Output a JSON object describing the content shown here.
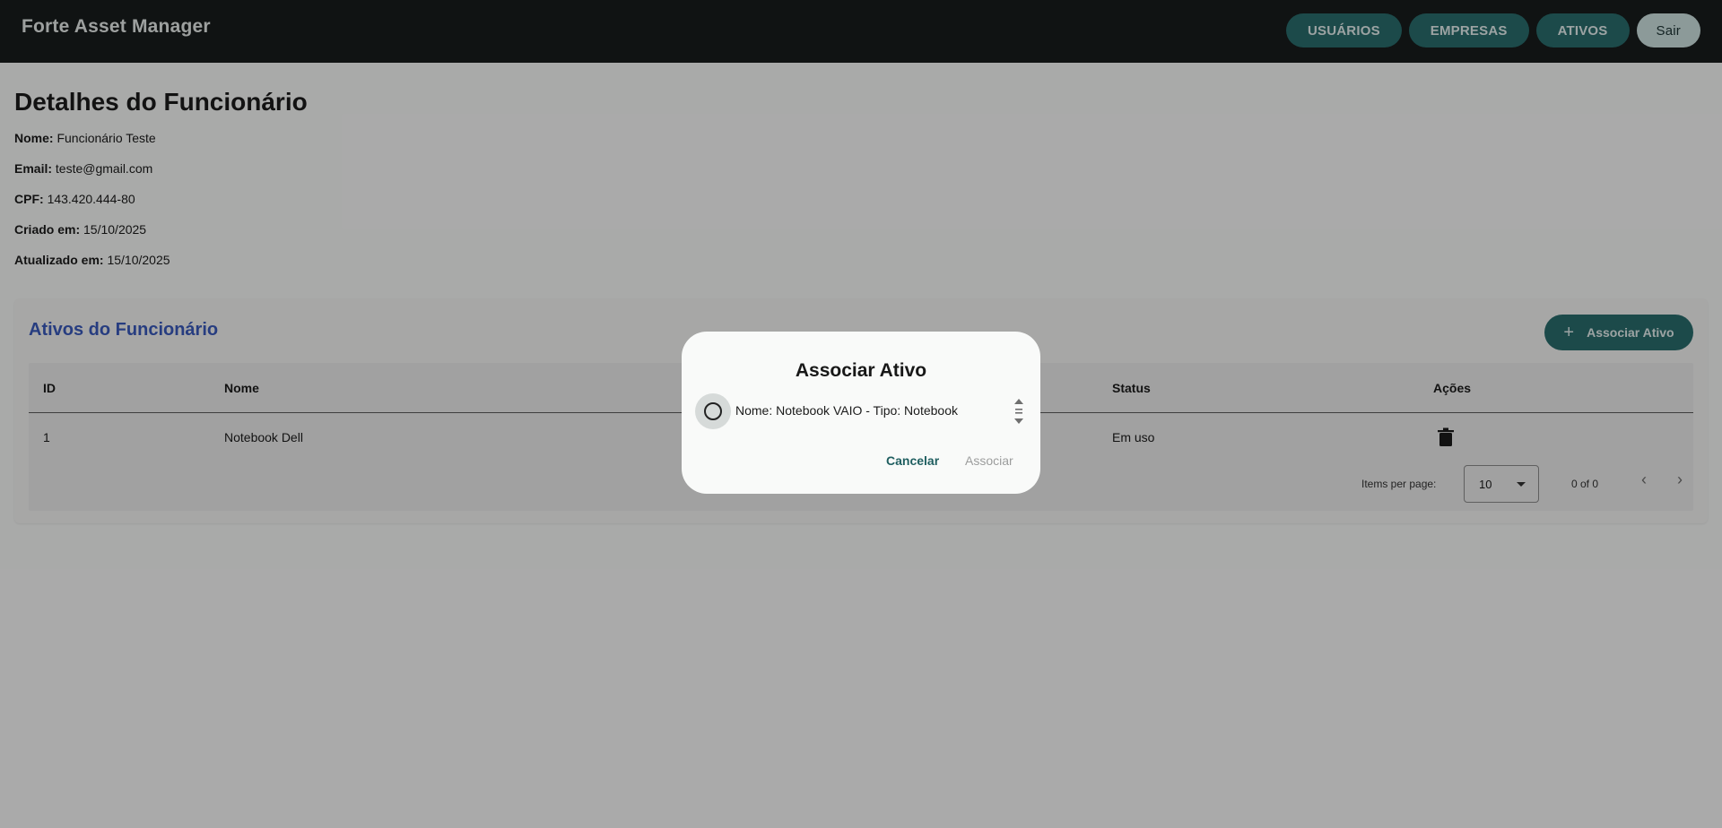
{
  "app": {
    "title": "Forte Asset Manager"
  },
  "nav": {
    "usuarios": "USUÁRIOS",
    "empresas": "EMPRESAS",
    "ativos": "ATIVOS",
    "sair": "Sair"
  },
  "details": {
    "title": "Detalhes do Funcionário",
    "fields": [
      {
        "label": "Nome:",
        "value": "Funcionário Teste"
      },
      {
        "label": "Email:",
        "value": "teste@gmail.com"
      },
      {
        "label": "CPF:",
        "value": "143.420.444-80"
      },
      {
        "label": "Criado em:",
        "value": "15/10/2025"
      },
      {
        "label": "Atualizado em:",
        "value": "15/10/2025"
      }
    ]
  },
  "assets": {
    "title": "Ativos do Funcionário",
    "associate_button": "Associar Ativo",
    "plus_symbol": "+",
    "columns": [
      "ID",
      "Nome",
      "Status",
      "Ações"
    ],
    "rows": [
      {
        "id": "1",
        "name": "Notebook Dell",
        "status": "Em uso"
      }
    ],
    "paginator": {
      "items_per_page_label": "Items per page:",
      "items_per_page_value": "10",
      "range_label": "0 of 0",
      "prev_symbol": "‹",
      "next_symbol": "›"
    }
  },
  "dialog": {
    "title": "Associar Ativo",
    "option": "Nome: Notebook VAIO - Tipo: Notebook",
    "option_selected": false,
    "cancel": "Cancelar",
    "confirm": "Associar"
  },
  "colors": {
    "header_bg": "#181c1c",
    "accent": "#2a6d6e",
    "card_title": "#3a5bbd"
  },
  "icons": {
    "delete": "trash-icon",
    "add": "plus-icon",
    "dropdown": "caret-down-icon",
    "prev": "chevron-left-icon",
    "next": "chevron-right-icon"
  }
}
